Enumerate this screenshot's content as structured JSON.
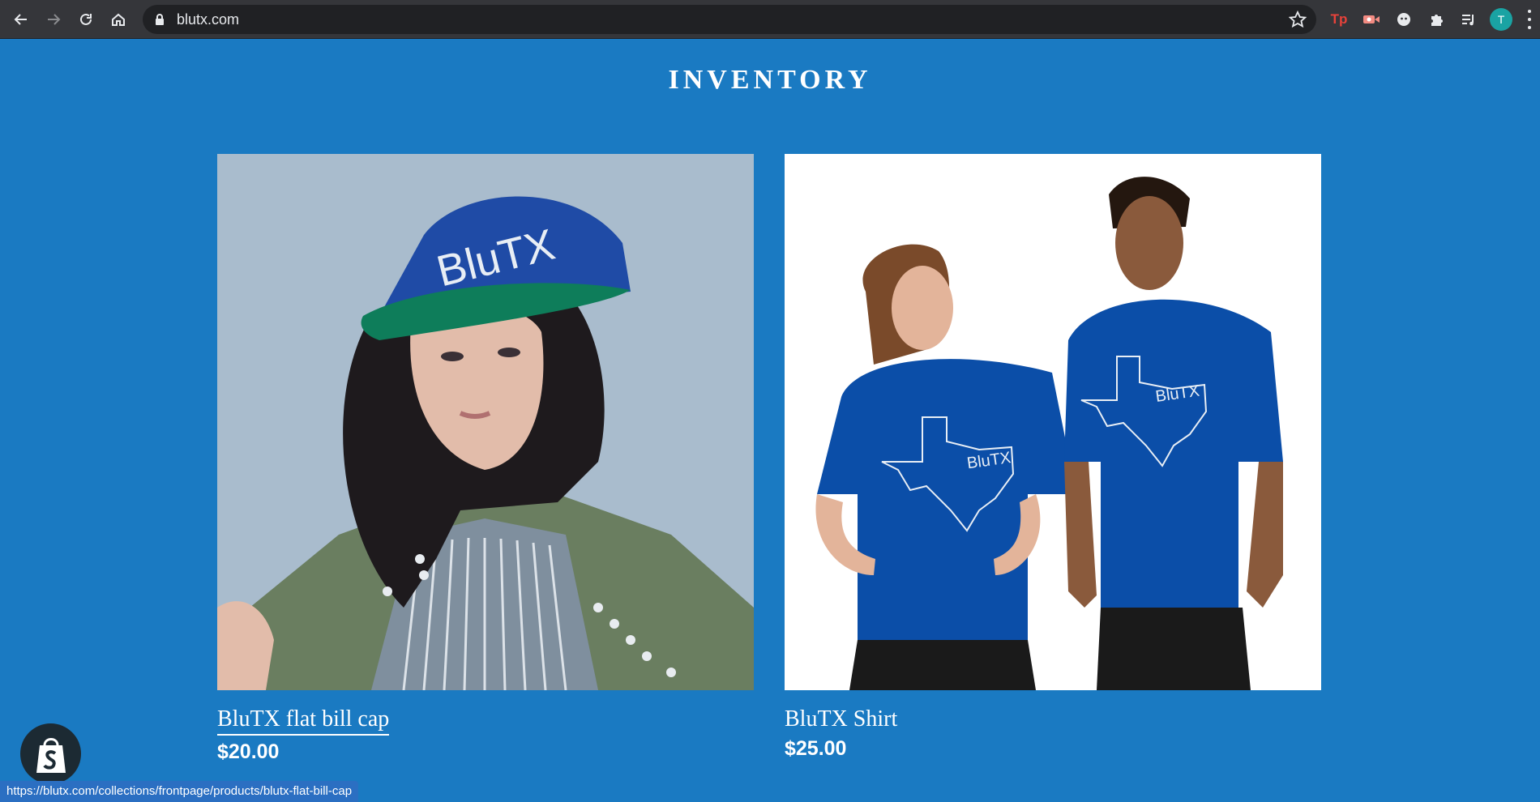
{
  "browser": {
    "url": "blutx.com",
    "status_url": "https://blutx.com/collections/frontpage/products/blutx-flat-bill-cap",
    "avatar_initial": "T",
    "extensions": [
      "tp-extension-icon",
      "screen-recorder-icon",
      "ghost-extension-icon",
      "puzzle-extensions-icon",
      "reading-list-icon"
    ]
  },
  "page": {
    "heading": "INVENTORY",
    "background_color": "#1a7ac2"
  },
  "products": [
    {
      "title": "BluTX flat bill cap",
      "price": "$20.00",
      "cap_text": "BluTX"
    },
    {
      "title": "BluTX Shirt",
      "price": "$25.00",
      "shirt_text_left": "BluTX",
      "shirt_text_right": "BluTX"
    }
  ],
  "colors": {
    "accent_blue": "#1a7ac2",
    "product_blue": "#0b4ea8"
  }
}
